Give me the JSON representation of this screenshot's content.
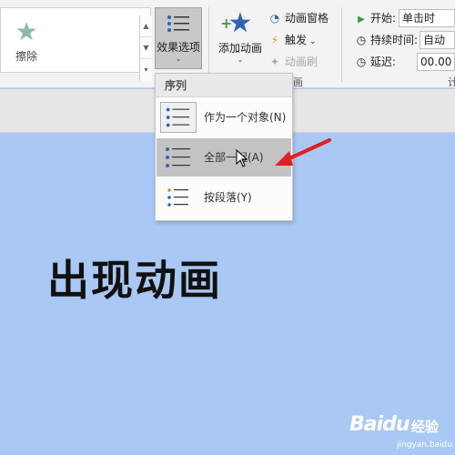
{
  "ribbon": {
    "gallery": {
      "wipe_label": "擦除"
    },
    "effect_options": {
      "label": "效果选项"
    },
    "add_animation": {
      "label": "添加动画"
    },
    "animation_pane": {
      "label": "动画窗格"
    },
    "trigger": {
      "label": "触发"
    },
    "animation_painter": {
      "label": "动画刷"
    },
    "group_label_advanced": "画",
    "group_label_timing": "计",
    "timing": {
      "start_label": "开始:",
      "start_value": "单击时",
      "duration_label": "持续时间:",
      "duration_value": "自动",
      "delay_label": "延迟:",
      "delay_value": "00.00"
    }
  },
  "menu": {
    "header": "序列",
    "items": [
      {
        "label": "作为一个对象(N)",
        "selected": false
      },
      {
        "label": "全部一起(A)",
        "selected": true
      },
      {
        "label": "按段落(Y)",
        "selected": false
      }
    ]
  },
  "slide": {
    "title": "出现动画"
  },
  "watermark": {
    "brand": "Baidu",
    "cn": "经验",
    "url": "jingyan.baidu.com"
  },
  "colors": {
    "slide_bg": "#a9c8f3",
    "selected_item": "#c3c3c3",
    "arrow": "#e02020"
  }
}
